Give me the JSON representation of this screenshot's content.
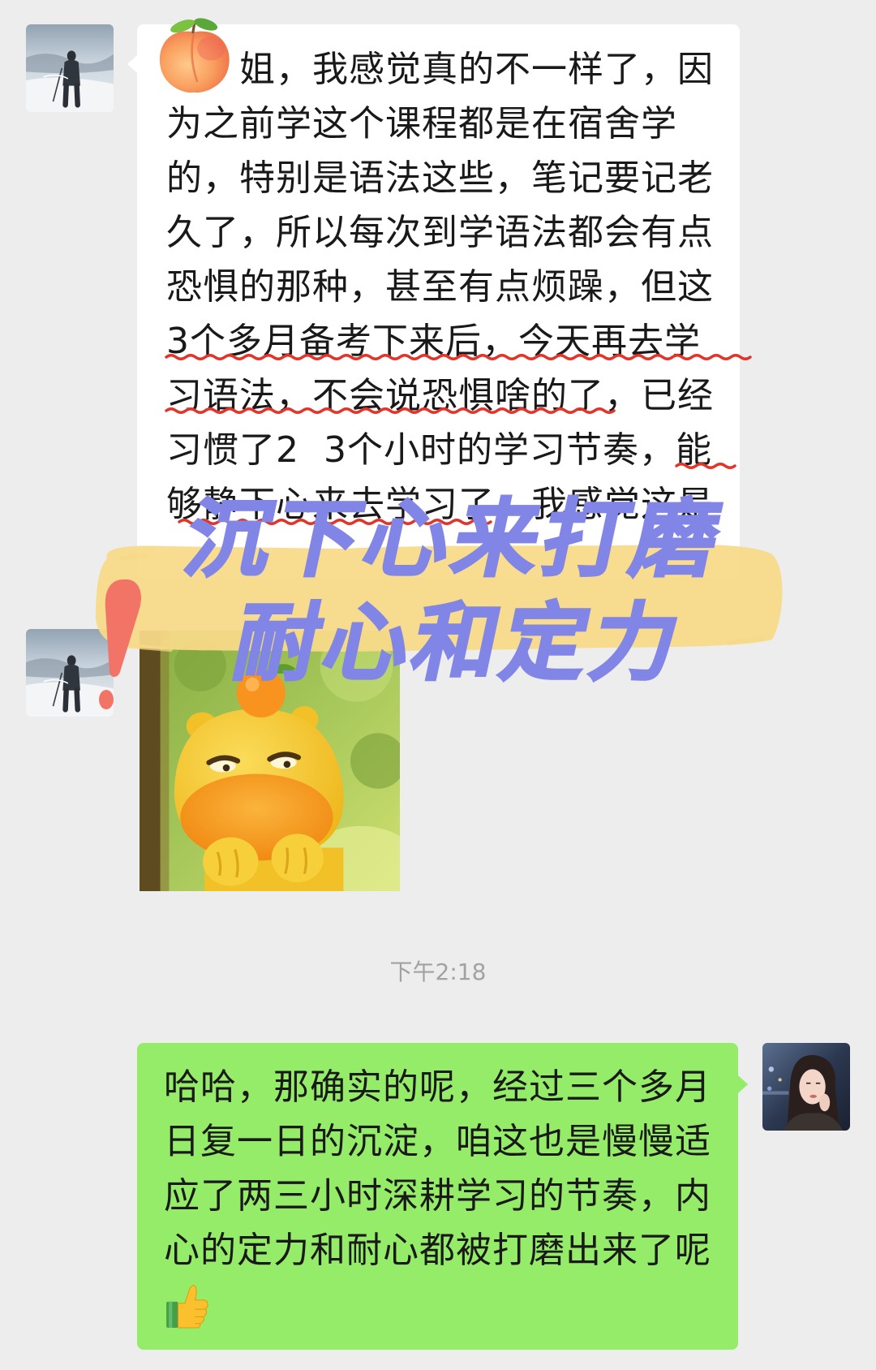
{
  "colors": {
    "page_background": "#ededed",
    "incoming_bubble": "#ffffff",
    "outgoing_bubble": "#95ec69",
    "message_text": "#191919",
    "timestamp_text": "#a2a2a2",
    "overlay_text": "#8085e6",
    "highlight_band": "#f8da88",
    "wavy_underline": "#e3342a",
    "exclamation_mark": "#f27466"
  },
  "icons": {
    "incoming_avatar": "contact-avatar-photo",
    "outgoing_avatar": "own-avatar-photo",
    "peach_sticker": "peach-icon",
    "image_sticker": "yellow-creature-sticker",
    "exclamation": "exclamation-mark-icon",
    "thumbs_up": "thumbs-up-icon"
  },
  "incoming": {
    "message_lines": [
      "姐，我感觉真的不一样了，因",
      "为之前学这个课程都是在宿舍学",
      "的，特别是语法这些，笔记要记老",
      "久了，所以每次到学语法都会有点",
      "恐惧的那种，甚至有点烦躁，但这",
      "3个多月备考下来后，今天再去学",
      "习语法，不会说恐惧啥的了，已经",
      "习惯了2  3个小时的学习节奏，能",
      "够静下心来去学习了，我感觉这是"
    ]
  },
  "timestamp": "下午2:18",
  "outgoing": {
    "message_lines": [
      "哈哈，那确实的呢，经过三个多月",
      "日复一日的沉淀，咱这也是慢慢适",
      "应了两三小时深耕学习的节奏，内",
      "心的定力和耐心都被打磨出来了呢"
    ]
  },
  "annotation_overlay": {
    "headline": "沉下心来打磨",
    "subline": "耐心和定力"
  }
}
